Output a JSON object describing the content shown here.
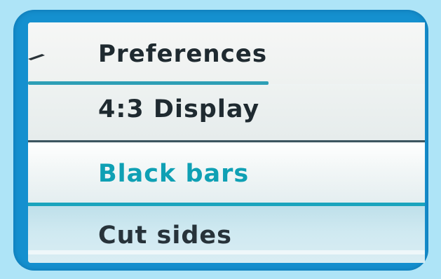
{
  "menu": {
    "header": "Preferences",
    "setting_title": "4:3 Display",
    "options": [
      {
        "label": "Black bars",
        "selected": true
      },
      {
        "label": "Cut sides",
        "selected": false
      }
    ]
  },
  "colors": {
    "frame": "#1590cf",
    "background": "#aee4f7",
    "selected_text": "#0fa0b4",
    "accent_line": "#1aa4bd"
  },
  "icons": {
    "back": "back-arrow-icon"
  }
}
